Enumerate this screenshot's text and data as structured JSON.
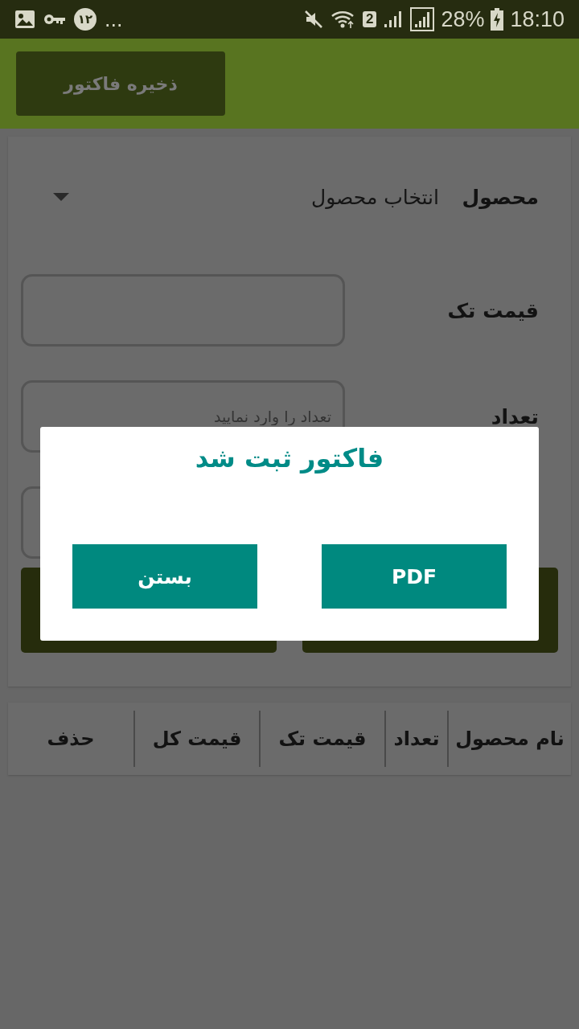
{
  "status_bar": {
    "badge": "۱۲",
    "overflow": "...",
    "sim": "2",
    "battery": "28%",
    "time": "18:10"
  },
  "app_bar": {
    "save_button": "ذخیره فاکتور"
  },
  "form": {
    "product": {
      "label": "محصول",
      "value": "انتخاب محصول"
    },
    "unit_price": {
      "label": "قیمت تک"
    },
    "quantity": {
      "label": "تعداد",
      "placeholder": "تعداد را وارد نمایید"
    }
  },
  "table": {
    "columns": [
      "نام محصول",
      "تعداد",
      "قیمت تک",
      "قیمت کل",
      "حذف"
    ]
  },
  "dialog": {
    "title": "فاکتور ثبت شد",
    "buttons": [
      "PDF",
      "بستن"
    ]
  }
}
